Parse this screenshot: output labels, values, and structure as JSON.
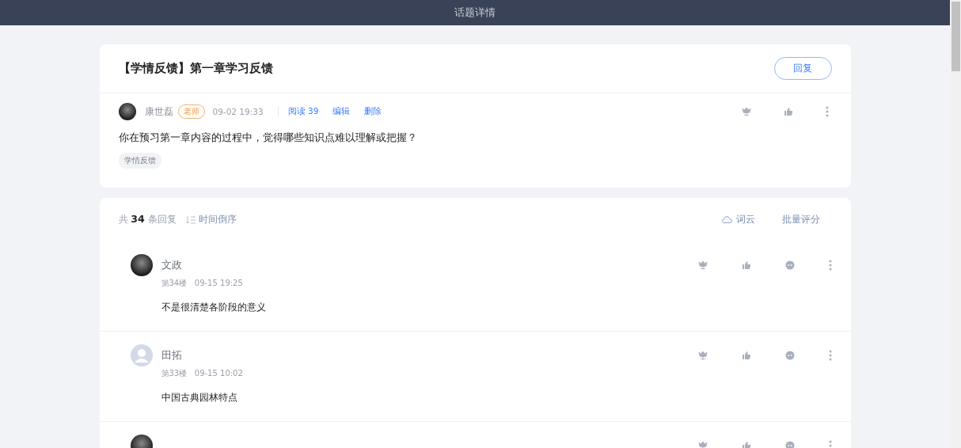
{
  "header": {
    "title": "话题详情"
  },
  "topic": {
    "title": "【学情反馈】第一章学习反馈",
    "reply_button": "回复",
    "author": "康世磊",
    "role_badge": "老师",
    "time": "09-02 19:33",
    "links": [
      "阅读 39",
      "编辑",
      "删除"
    ],
    "content": "你在预习第一章内容的过程中，觉得哪些知识点难以理解或把握？",
    "tags": [
      "学情反馈"
    ]
  },
  "replies_panel": {
    "summary": "共 **34** 条回复",
    "sort": "时间倒序",
    "word_cloud": "词云",
    "batch_score": "批量评分",
    "replies": [
      {
        "custom_avatar": true,
        "name": "文政",
        "floor": "第34楼",
        "time": "09-15 19:25",
        "content": "不是很清楚各阶段的意义"
      },
      {
        "custom_avatar": false,
        "name": "田拓",
        "floor": "第33楼",
        "time": "09-15 10:02",
        "content": "中国古典园林特点"
      },
      {
        "custom_avatar": true
      }
    ]
  }
}
